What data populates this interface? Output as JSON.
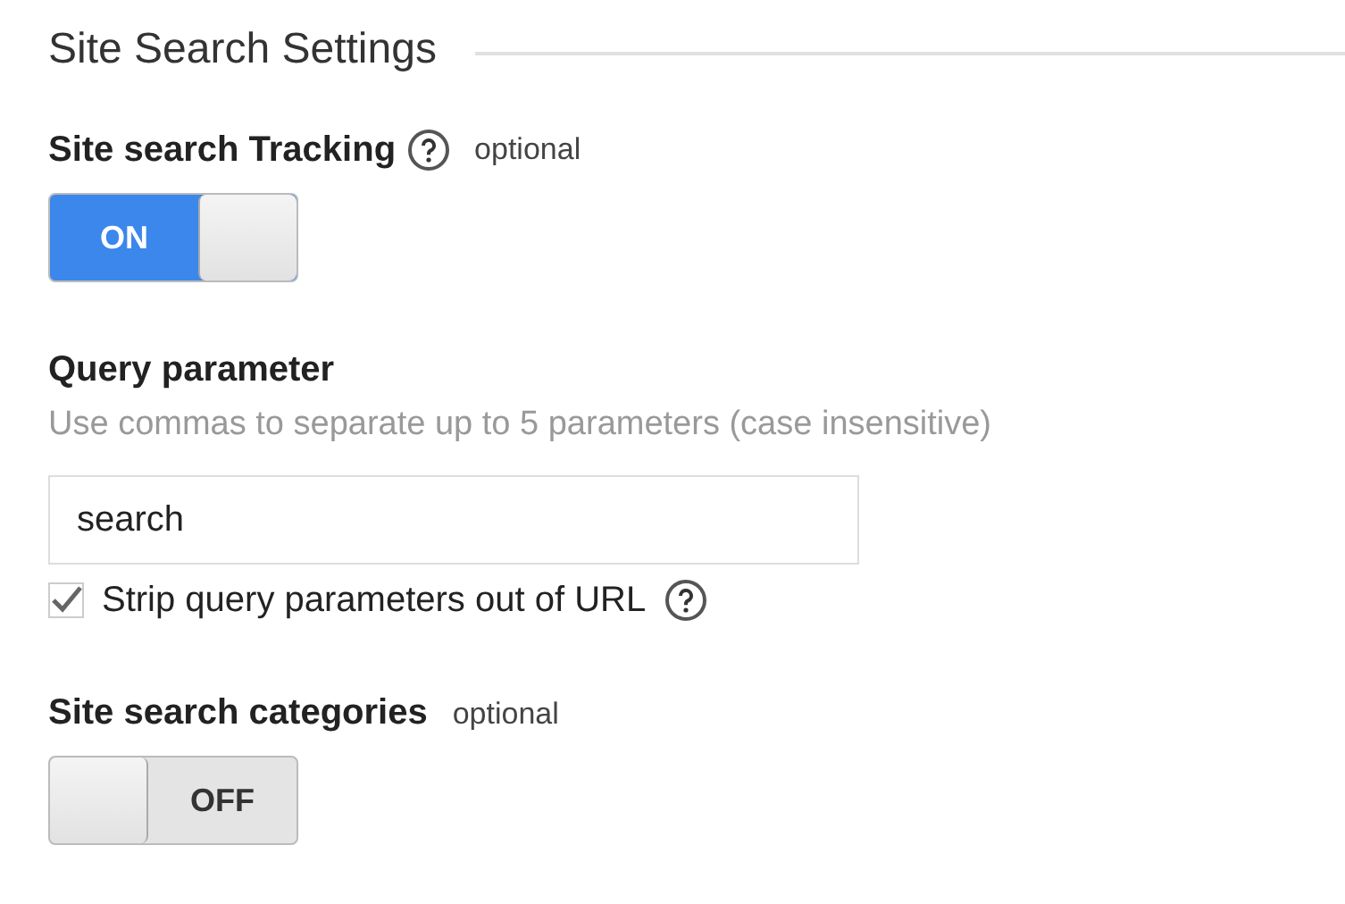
{
  "section": {
    "title": "Site Search Settings"
  },
  "tracking": {
    "label": "Site search Tracking",
    "note": "optional",
    "toggle": {
      "on": true,
      "text": "ON"
    }
  },
  "query": {
    "label": "Query parameter",
    "hint": "Use commas to separate up to 5 parameters (case insensitive)",
    "field": {
      "value": "search"
    },
    "strip": {
      "label": "Strip query parameters out of URL",
      "checked": true
    }
  },
  "categories": {
    "label": "Site search categories",
    "note": "optional",
    "toggle": {
      "on": false,
      "text": "OFF"
    }
  }
}
